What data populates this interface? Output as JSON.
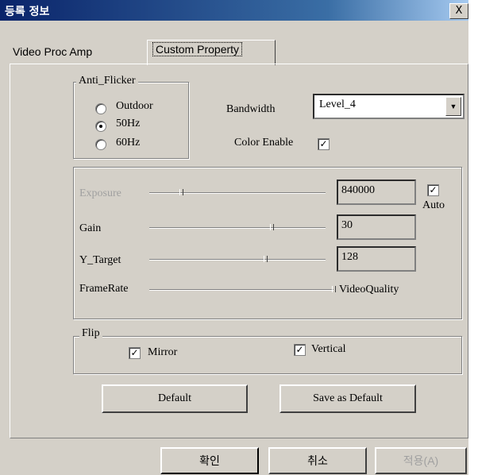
{
  "window": {
    "title": "등록 정보",
    "close_label": "X"
  },
  "tabs": [
    {
      "label": "Video Proc Amp",
      "active": false
    },
    {
      "label": "Custom Property",
      "active": true
    }
  ],
  "anti_flicker": {
    "label": "Anti_Flicker",
    "options": [
      {
        "label": "Outdoor",
        "checked": false
      },
      {
        "label": "50Hz",
        "checked": true
      },
      {
        "label": "60Hz",
        "checked": false
      }
    ]
  },
  "bandwidth": {
    "label": "Bandwidth",
    "value": "Level_4"
  },
  "color_enable": {
    "label": "Color Enable",
    "checked": true
  },
  "exposure": {
    "label": "Exposure",
    "value": "840000",
    "enabled": false
  },
  "auto": {
    "label": "Auto",
    "checked": true
  },
  "gain": {
    "label": "Gain",
    "value": "30"
  },
  "y_target": {
    "label": "Y_Target",
    "value": "128"
  },
  "framerate": {
    "label": "FrameRate",
    "right_label": "VideoQuality"
  },
  "flip": {
    "label": "Flip",
    "mirror_label": "Mirror",
    "mirror_checked": true,
    "vertical_label": "Vertical",
    "vertical_checked": true
  },
  "buttons": {
    "default": "Default",
    "save_as_default": "Save as Default"
  },
  "footer": {
    "ok": "확인",
    "cancel": "취소",
    "apply": "적용(A)"
  },
  "check_glyph": "✓"
}
